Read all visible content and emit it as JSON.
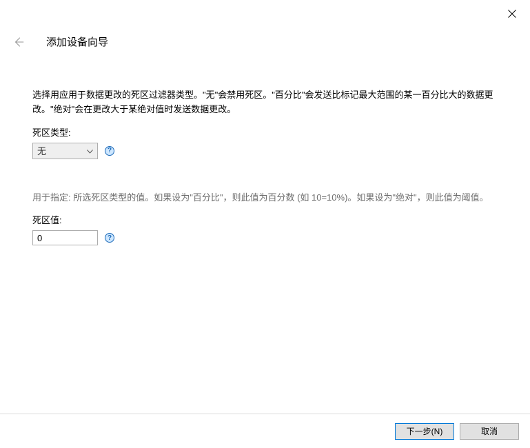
{
  "wizard": {
    "title": "添加设备向导"
  },
  "content": {
    "description": "选择用应用于数据更改的死区过滤器类型。\"无\"会禁用死区。\"百分比\"会发送比标记最大范围的某一百分比大的数据更改。\"绝对\"会在更改大于某绝对值时发送数据更改。",
    "deadband_type_label": "死区类型:",
    "deadband_type_value": "无",
    "secondary_description": "用于指定: 所选死区类型的值。如果设为\"百分比\"，则此值为百分数 (如 10=10%)。如果设为\"绝对\"，则此值为阈值。",
    "deadband_value_label": "死区值:",
    "deadband_value": "0"
  },
  "footer": {
    "next_label": "下一步(N)",
    "cancel_label": "取消"
  }
}
